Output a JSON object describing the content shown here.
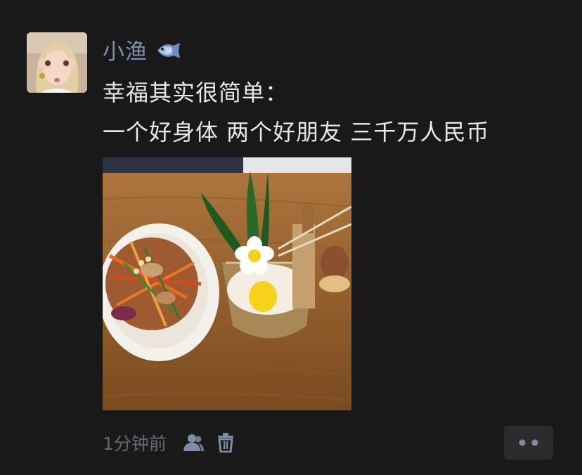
{
  "post": {
    "author": {
      "name": "小渔",
      "badge_icon": "fish-icon"
    },
    "content": {
      "lines": [
        "幸福其实很简单：",
        "一个好身体 两个好朋友 三千万人民币"
      ]
    },
    "images": [
      {
        "description": "food-photo"
      }
    ],
    "footer": {
      "time": "1分钟前",
      "privacy_icon": "users-icon",
      "delete_icon": "trash-icon",
      "more_icon": "more-dots-icon"
    }
  },
  "colors": {
    "background": "#191919",
    "name": "#7d90ad",
    "text": "#e8e8e8",
    "meta": "#626a77",
    "icon": "#7e8da6",
    "more_bg": "#2c2c2c"
  }
}
